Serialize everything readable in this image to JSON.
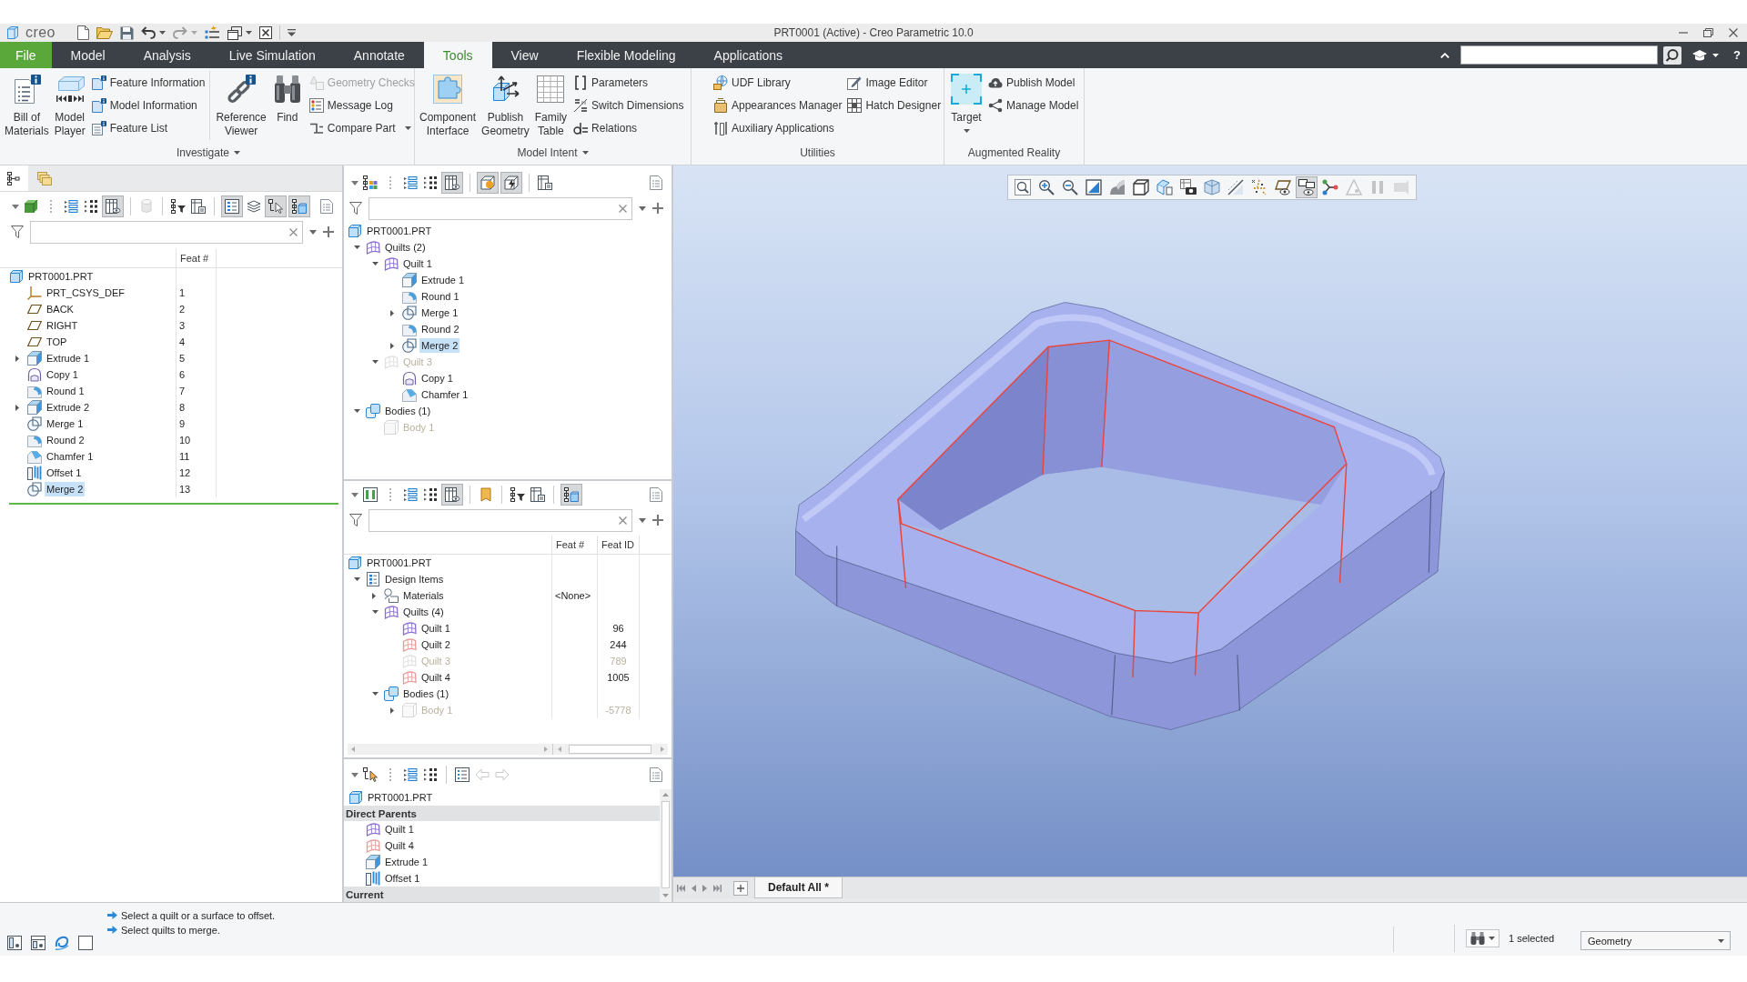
{
  "title_bar": {
    "logo": "creo",
    "quick_access": [
      {
        "disabled": false,
        "dropdown": false
      },
      {
        "disabled": false,
        "dropdown": false
      },
      {
        "disabled": false,
        "dropdown": false
      },
      {
        "disabled": false,
        "dropdown": true
      },
      {
        "disabled": true,
        "dropdown": true
      },
      {
        "disabled": false,
        "dropdown": false
      },
      {
        "disabled": false,
        "dropdown": true
      },
      {
        "disabled": false,
        "dropdown": false
      },
      {
        "disabled": false,
        "dropdown": false
      }
    ],
    "title": "PRT0001 (Active) - Creo Parametric 10.0"
  },
  "tab_bar": {
    "tabs": [
      {
        "label": "File",
        "kind": "file",
        "selected": false
      },
      {
        "label": "Model",
        "kind": "tab",
        "selected": false
      },
      {
        "label": "Analysis",
        "kind": "tab",
        "selected": false
      },
      {
        "label": "Live Simulation",
        "kind": "tab",
        "selected": false
      },
      {
        "label": "Annotate",
        "kind": "tab",
        "selected": false
      },
      {
        "label": "Tools",
        "kind": "tab",
        "selected": true
      },
      {
        "label": "View",
        "kind": "tab",
        "selected": false
      },
      {
        "label": "Flexible Modeling",
        "kind": "tab",
        "selected": false
      },
      {
        "label": "Applications",
        "kind": "tab",
        "selected": false
      }
    ],
    "help": "?"
  },
  "ribbon_groups": [
    {
      "label": "Investigate",
      "dropdown": true,
      "columns": [
        {
          "kind": "large",
          "buttons": [
            {
              "label": "Bill of\nMaterials",
              "disabled": false,
              "dropdown": false
            },
            {
              "label": "Model\nPlayer",
              "disabled": false,
              "dropdown": false
            }
          ]
        },
        {
          "kind": "stack",
          "buttons": [
            {
              "label": "Feature Information",
              "disabled": false,
              "dropdown": false
            },
            {
              "label": "Model Information",
              "disabled": false,
              "dropdown": false
            },
            {
              "label": "Feature List",
              "disabled": false,
              "dropdown": false
            }
          ]
        },
        {
          "kind": "separator"
        },
        {
          "kind": "large",
          "buttons": [
            {
              "label": "Reference\nViewer",
              "disabled": false,
              "dropdown": false
            },
            {
              "label": "Find",
              "disabled": false,
              "dropdown": false
            }
          ]
        },
        {
          "kind": "stack",
          "buttons": [
            {
              "label": "Geometry Checks",
              "disabled": true,
              "dropdown": false
            },
            {
              "label": "Message Log",
              "disabled": false,
              "dropdown": false
            },
            {
              "label": "Compare Part",
              "disabled": false,
              "dropdown": true
            }
          ]
        }
      ]
    },
    {
      "label": "Model Intent",
      "dropdown": true,
      "columns": [
        {
          "kind": "large",
          "buttons": [
            {
              "label": "Component\nInterface",
              "disabled": false,
              "dropdown": false
            },
            {
              "label": "Publish\nGeometry",
              "disabled": false,
              "dropdown": false
            },
            {
              "label": "Family\nTable",
              "disabled": false,
              "dropdown": false
            }
          ]
        },
        {
          "kind": "stack",
          "buttons": [
            {
              "label": "Parameters",
              "disabled": false,
              "dropdown": false
            },
            {
              "label": "Switch Dimensions",
              "disabled": false,
              "dropdown": false
            },
            {
              "label": "Relations",
              "disabled": false,
              "dropdown": false
            }
          ]
        }
      ]
    },
    {
      "label": "Utilities",
      "dropdown": false,
      "columns": [
        {
          "kind": "stack",
          "buttons": [
            {
              "label": "UDF Library",
              "disabled": false,
              "dropdown": false
            },
            {
              "label": "Appearances Manager",
              "disabled": false,
              "dropdown": false
            },
            {
              "label": "Auxiliary Applications",
              "disabled": false,
              "dropdown": false
            }
          ]
        },
        {
          "kind": "stack",
          "buttons": [
            {
              "label": "Image Editor",
              "disabled": false,
              "dropdown": false
            },
            {
              "label": "Hatch Designer",
              "disabled": false,
              "dropdown": false
            }
          ]
        }
      ]
    },
    {
      "label": "Augmented Reality",
      "dropdown": false,
      "columns": [
        {
          "kind": "large",
          "buttons": [
            {
              "label": "Target",
              "disabled": false,
              "dropdown": true
            }
          ]
        },
        {
          "kind": "stack",
          "buttons": [
            {
              "label": "Publish Model",
              "disabled": false,
              "dropdown": false
            },
            {
              "label": "Manage Model",
              "disabled": false,
              "dropdown": false
            }
          ]
        }
      ]
    }
  ],
  "model_tree_panel": {
    "tabs": [
      {
        "selected": true
      },
      {
        "selected": false
      }
    ],
    "tools": [
      {
        "pressed": false,
        "disabled": false
      },
      {
        "pressed": false,
        "disabled": false
      },
      {
        "pressed": false,
        "disabled": false
      },
      {
        "pressed": true,
        "disabled": false
      },
      {
        "pressed": false,
        "disabled": true
      },
      {
        "pressed": false,
        "disabled": false
      },
      {
        "pressed": false,
        "disabled": false
      },
      {
        "pressed": true,
        "disabled": false
      },
      {
        "pressed": false,
        "disabled": false
      },
      {
        "pressed": true,
        "disabled": false
      },
      {
        "pressed": true,
        "disabled": false
      },
      {
        "pressed": false,
        "disabled": false
      }
    ],
    "columns": [
      "Feat #"
    ],
    "tree": [
      {
        "label": "PRT0001.PRT",
        "kind": "part",
        "selected": false,
        "inactive": false,
        "children": [
          {
            "label": "PRT_CSYS_DEF",
            "kind": "csys",
            "selected": false,
            "inactive": false,
            "feat_no": "1"
          },
          {
            "label": "BACK",
            "kind": "plane",
            "selected": false,
            "inactive": false,
            "feat_no": "2"
          },
          {
            "label": "RIGHT",
            "kind": "plane",
            "selected": false,
            "inactive": false,
            "feat_no": "3"
          },
          {
            "label": "TOP",
            "kind": "plane",
            "selected": false,
            "inactive": false,
            "feat_no": "4"
          },
          {
            "label": "Extrude 1",
            "kind": "extrude",
            "selected": false,
            "inactive": false,
            "expanded": false,
            "feat_no": "5"
          },
          {
            "label": "Copy 1",
            "kind": "copy",
            "selected": false,
            "inactive": false,
            "feat_no": "6"
          },
          {
            "label": "Round 1",
            "kind": "round",
            "selected": false,
            "inactive": false,
            "feat_no": "7"
          },
          {
            "label": "Extrude 2",
            "kind": "extrude",
            "selected": false,
            "inactive": false,
            "expanded": false,
            "feat_no": "8"
          },
          {
            "label": "Merge 1",
            "kind": "merge",
            "selected": false,
            "inactive": false,
            "feat_no": "9"
          },
          {
            "label": "Round 2",
            "kind": "round",
            "selected": false,
            "inactive": false,
            "feat_no": "10"
          },
          {
            "label": "Chamfer 1",
            "kind": "chamfer",
            "selected": false,
            "inactive": false,
            "feat_no": "11"
          },
          {
            "label": "Offset 1",
            "kind": "offset",
            "selected": false,
            "inactive": false,
            "feat_no": "12"
          },
          {
            "label": "Merge 2",
            "kind": "merge",
            "selected": true,
            "inactive": false,
            "feat_no": "13"
          }
        ]
      }
    ]
  },
  "quilt_tree_panel": {
    "tools": [
      {
        "pressed": false,
        "disabled": false
      },
      {
        "pressed": false,
        "disabled": false
      },
      {
        "pressed": false,
        "disabled": false
      },
      {
        "pressed": true,
        "disabled": false
      },
      {
        "pressed": true,
        "disabled": false
      },
      {
        "pressed": true,
        "disabled": false
      },
      {
        "pressed": false,
        "disabled": false
      },
      {
        "pressed": false,
        "disabled": false
      }
    ],
    "tree": [
      {
        "label": "PRT0001.PRT",
        "kind": "part",
        "selected": false,
        "inactive": false,
        "children": [
          {
            "label": "Quilts (2)",
            "kind": "quilts",
            "selected": false,
            "inactive": false,
            "expanded": true,
            "children": [
              {
                "label": "Quilt 1",
                "kind": "quilt",
                "color": "#8a6dcf",
                "selected": false,
                "inactive": false,
                "expanded": true,
                "children": [
                  {
                    "label": "Extrude 1",
                    "kind": "extrude",
                    "selected": false,
                    "inactive": false
                  },
                  {
                    "label": "Round 1",
                    "kind": "round",
                    "selected": false,
                    "inactive": false
                  },
                  {
                    "label": "Merge 1",
                    "kind": "merge",
                    "selected": false,
                    "inactive": false,
                    "expanded": false
                  },
                  {
                    "label": "Round 2",
                    "kind": "round",
                    "selected": false,
                    "inactive": false
                  },
                  {
                    "label": "Merge 2",
                    "kind": "merge",
                    "selected": true,
                    "inactive": false,
                    "expanded": false
                  }
                ]
              },
              {
                "label": "Quilt 3",
                "kind": "quilt",
                "selected": false,
                "inactive": true,
                "expanded": true,
                "children": [
                  {
                    "label": "Copy 1",
                    "kind": "copy",
                    "selected": false,
                    "inactive": false
                  },
                  {
                    "label": "Chamfer 1",
                    "kind": "chamfer",
                    "selected": false,
                    "inactive": false
                  }
                ]
              }
            ]
          },
          {
            "label": "Bodies (1)",
            "kind": "bodies",
            "selected": false,
            "inactive": false,
            "expanded": true,
            "children": [
              {
                "label": "Body 1",
                "kind": "body",
                "selected": false,
                "inactive": true
              }
            ]
          }
        ]
      }
    ]
  },
  "design_items_panel": {
    "tools": [
      {
        "pressed": false,
        "disabled": false
      },
      {
        "pressed": false,
        "disabled": false
      },
      {
        "pressed": false,
        "disabled": false
      },
      {
        "pressed": true,
        "disabled": false
      },
      {
        "pressed": false,
        "disabled": false
      },
      {
        "pressed": false,
        "disabled": false
      },
      {
        "pressed": false,
        "disabled": false
      },
      {
        "pressed": true,
        "disabled": false
      },
      {
        "pressed": false,
        "disabled": false
      }
    ],
    "columns": [
      "Feat #",
      "Feat ID"
    ],
    "tree": [
      {
        "label": "PRT0001.PRT",
        "kind": "part",
        "selected": false,
        "inactive": false,
        "children": [
          {
            "label": "Design Items",
            "kind": "design-items",
            "selected": false,
            "inactive": false,
            "expanded": true,
            "children": [
              {
                "label": "Materials",
                "kind": "materials",
                "selected": false,
                "inactive": false,
                "expanded": false,
                "feat_no": "<None>"
              },
              {
                "label": "Quilts (4)",
                "kind": "quilts",
                "selected": false,
                "inactive": false,
                "expanded": true,
                "children": [
                  {
                    "label": "Quilt 1",
                    "kind": "quilt",
                    "color": "#8a6dcf",
                    "selected": false,
                    "inactive": false,
                    "feat_id": "96"
                  },
                  {
                    "label": "Quilt 2",
                    "kind": "quilt",
                    "color": "#e79a98",
                    "selected": false,
                    "inactive": false,
                    "feat_id": "244"
                  },
                  {
                    "label": "Quilt 3",
                    "kind": "quilt",
                    "selected": false,
                    "inactive": true,
                    "feat_id": "789"
                  },
                  {
                    "label": "Quilt 4",
                    "kind": "quilt",
                    "color": "#e79a98",
                    "selected": false,
                    "inactive": false,
                    "feat_id": "1005"
                  }
                ]
              },
              {
                "label": "Bodies (1)",
                "kind": "bodies",
                "selected": false,
                "inactive": false,
                "expanded": true,
                "children": [
                  {
                    "label": "Body 1",
                    "kind": "body",
                    "selected": false,
                    "inactive": true,
                    "expanded": false,
                    "feat_id": "-5778"
                  }
                ]
              }
            ]
          }
        ]
      }
    ]
  },
  "reference_panel": {
    "tools": [
      {
        "pressed": false,
        "disabled": false
      },
      {
        "pressed": false,
        "disabled": false
      },
      {
        "pressed": false,
        "disabled": false
      },
      {
        "pressed": false,
        "disabled": false
      },
      {
        "pressed": false,
        "disabled": true
      },
      {
        "pressed": false,
        "disabled": true
      },
      {
        "pressed": false,
        "disabled": false
      }
    ],
    "root": {
      "label": "PRT0001.PRT",
      "kind": "part"
    },
    "sections": [
      {
        "label": "Direct Parents",
        "items": [
          {
            "label": "Quilt 1",
            "kind": "quilt",
            "color": "#8a6dcf",
            "selected": false
          },
          {
            "label": "Quilt 4",
            "kind": "quilt",
            "color": "#e79a98",
            "selected": false
          },
          {
            "label": "Extrude 1",
            "kind": "extrude",
            "selected": false
          },
          {
            "label": "Offset 1",
            "kind": "offset",
            "selected": false
          }
        ]
      },
      {
        "label": "Current"
      }
    ]
  },
  "graphics_window": {
    "tools": [
      {
        "pressed": false,
        "disabled": false
      },
      {
        "pressed": false,
        "disabled": false
      },
      {
        "pressed": false,
        "disabled": false
      },
      {
        "pressed": false,
        "disabled": false
      },
      {
        "pressed": false,
        "disabled": false
      },
      {
        "pressed": false,
        "disabled": false
      },
      {
        "pressed": false,
        "disabled": false
      },
      {
        "pressed": false,
        "disabled": false
      },
      {
        "pressed": false,
        "disabled": false
      },
      {
        "pressed": false,
        "disabled": false
      },
      {
        "pressed": false,
        "disabled": false
      },
      {
        "pressed": false,
        "disabled": false
      },
      {
        "pressed": true,
        "disabled": false
      },
      {
        "pressed": false,
        "disabled": false
      },
      {
        "pressed": false,
        "disabled": true
      },
      {
        "pressed": false,
        "disabled": true
      },
      {
        "pressed": false,
        "disabled": true
      }
    ],
    "tabs": [
      {
        "label": "Default All *",
        "selected": true
      }
    ]
  },
  "status_bar": {
    "messages": [
      "Select a quilt or a surface to offset.",
      "Select quilts to merge."
    ],
    "selection": "1 selected",
    "filter": "Geometry"
  }
}
